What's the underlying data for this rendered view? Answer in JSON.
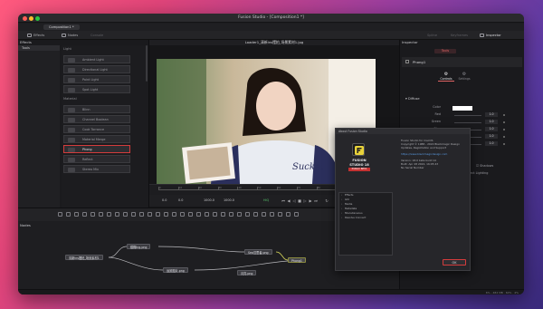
{
  "window": {
    "title": "Fusion Studio - [Composition1 *]"
  },
  "tabbar": {
    "composition_tab": "Composition1 *"
  },
  "toolbar": {
    "effects": "Effects",
    "nodes": "Nodes",
    "console": "Console",
    "spline": "Spline",
    "keyframes": "Keyframes",
    "inspector": "Inspector"
  },
  "effects_panel": {
    "title": "Effects",
    "tree": [
      "Tools"
    ],
    "light_section": "Light",
    "light_items": [
      "Ambient Light",
      "Directional Light",
      "Point Light",
      "Spot Light"
    ],
    "material_section": "Material",
    "material_items": [
      "Blinn",
      "Channel Boolean",
      "Cook Torrance",
      "Material Merge",
      "Phong",
      "Reflect",
      "Stereo Mix"
    ]
  },
  "viewer": {
    "title": "Loader1_清新ins摆拍_场景素材1.jpg",
    "ruler_labels": [
      "0",
      "10",
      "20",
      "30",
      "40",
      "50",
      "60",
      "70",
      "80",
      "90",
      "100",
      "110",
      "120"
    ],
    "transport": {
      "cur": "0.0",
      "start": "0.0",
      "end": "1000.0",
      "dur": "1000.0",
      "mode": "HiQ"
    }
  },
  "inspector": {
    "title": "Inspector",
    "tools_tab": "Tools",
    "node_name": "Phong1",
    "subtabs": [
      "Controls",
      "Settings"
    ],
    "section": "Diffuse",
    "props": [
      {
        "label": "Color",
        "value": ""
      },
      {
        "label": "Red",
        "value": "1.0"
      },
      {
        "label": "Green",
        "value": "1.0"
      },
      {
        "label": "Blue",
        "value": "1.0"
      },
      {
        "label": "Alpha",
        "value": "1.0"
      },
      {
        "label": "Opacity",
        "value": "1.0"
      }
    ],
    "lighting_label": "Lighting",
    "shadows_label": "Shadows",
    "use_object_lighting": "Use Object Lighting",
    "color_accent": "#e06464"
  },
  "nodes_panel": {
    "title": "Nodes",
    "nodes": [
      {
        "label": "清新ins摆拍_场景素材1"
      },
      {
        "label": "模糊ing.png"
      },
      {
        "label": "Sea沉思者.png"
      },
      {
        "label": "Phong1"
      },
      {
        "label": "远景图片.png"
      },
      {
        "label": "月亮.png"
      }
    ]
  },
  "statusbar": {
    "text": "6% - 482 MB   ·   60%   ·   4%"
  },
  "about": {
    "title": "About Fusion Studio",
    "brand_line1": "FUSION",
    "brand_line2": "STUDIO 18",
    "badge": "PUBLIC BETA",
    "lines": [
      "Fusion Studio for macOS",
      "Copyright © 1988 - 2022 Blackmagic Design",
      "Updates, Registration and Support"
    ],
    "link": "https://www.blackmagicdesign.com",
    "version_lines": [
      "Version: 18.0 beta build 14",
      "Built: Apr 28 2022, 16:05:43",
      "No Serial Number"
    ],
    "credits": [
      "Effects",
      "GUI",
      "Media",
      "Metadata",
      "Miscellaneous",
      "Resolve Connect"
    ],
    "ok_label": "OK"
  }
}
